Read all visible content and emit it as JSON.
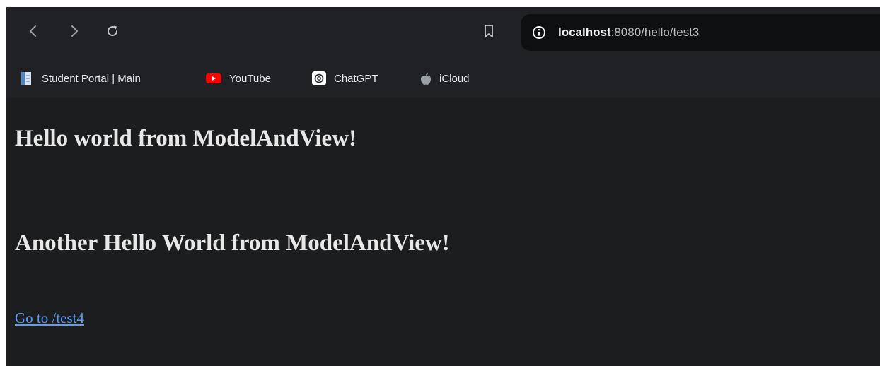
{
  "browser": {
    "url_host": "localhost",
    "url_path": ":8080/hello/test3",
    "bookmarks": [
      {
        "label": "Student Portal | Main",
        "icon": "document-icon"
      },
      {
        "label": "YouTube",
        "icon": "youtube-icon"
      },
      {
        "label": "ChatGPT",
        "icon": "chatgpt-icon"
      },
      {
        "label": "iCloud",
        "icon": "apple-icon"
      }
    ]
  },
  "page": {
    "heading1": "Hello world from ModelAndView!",
    "heading2": "Another Hello World from ModelAndView!",
    "link_text": "Go to /test4"
  },
  "colors": {
    "toolbar_bg": "#202124",
    "page_bg": "#1c1d1f",
    "link": "#5c9cf5",
    "youtube_red": "#ff0000"
  }
}
